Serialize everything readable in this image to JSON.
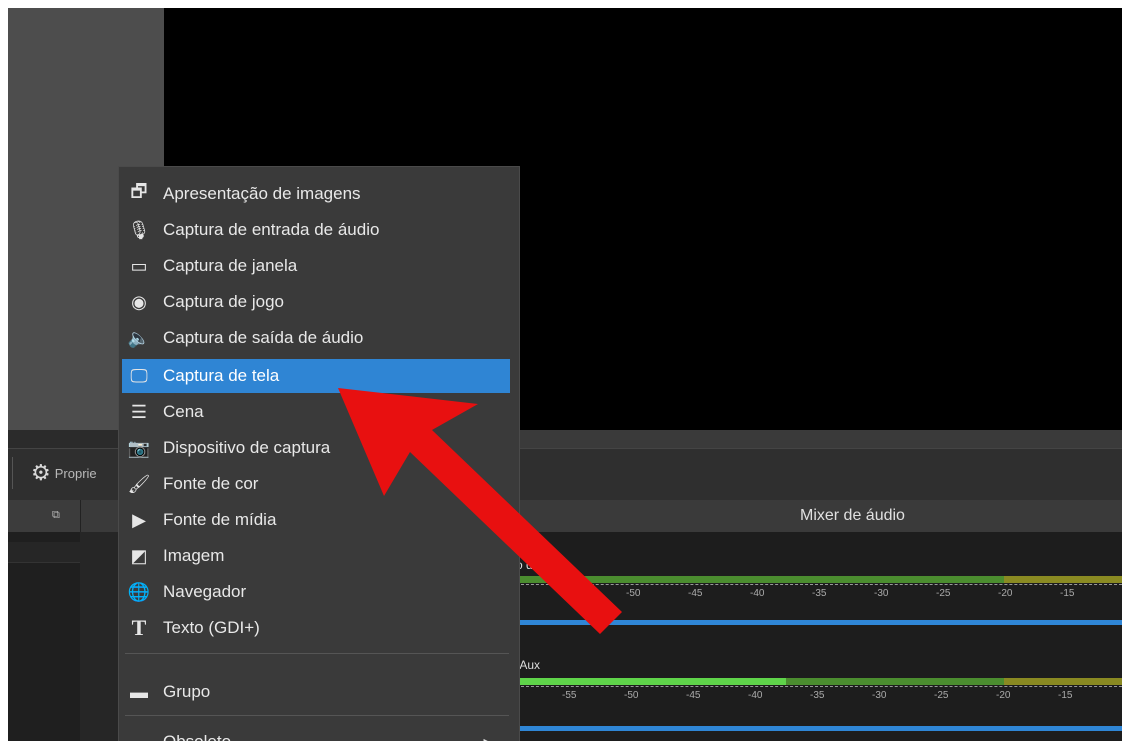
{
  "toolbar": {
    "properties_label": "Proprie"
  },
  "mixer": {
    "title": "Mixer de áudio",
    "tracks": [
      {
        "label": "o desktop",
        "ticks": [
          "-50",
          "-45",
          "-40",
          "-35",
          "-30",
          "-25",
          "-20",
          "-15"
        ]
      },
      {
        "label": "/Aux",
        "ticks": [
          "-55",
          "-50",
          "-45",
          "-40",
          "-35",
          "-30",
          "-25",
          "-20",
          "-15"
        ]
      }
    ]
  },
  "menu": {
    "items": [
      {
        "label": "Apresentação de imagens",
        "icon": "slideshow-icon"
      },
      {
        "label": "Captura de entrada de áudio",
        "icon": "microphone-icon"
      },
      {
        "label": "Captura de janela",
        "icon": "window-icon"
      },
      {
        "label": "Captura de jogo",
        "icon": "gamepad-icon"
      },
      {
        "label": "Captura de saída de áudio",
        "icon": "speaker-icon"
      },
      {
        "label": "Captura de tela",
        "icon": "monitor-icon",
        "selected": true
      },
      {
        "label": "Cena",
        "icon": "list-icon"
      },
      {
        "label": "Dispositivo de captura",
        "icon": "camera-icon"
      },
      {
        "label": "Fonte de cor",
        "icon": "brush-icon"
      },
      {
        "label": "Fonte de mídia",
        "icon": "play-icon"
      },
      {
        "label": "Imagem",
        "icon": "image-icon"
      },
      {
        "label": "Navegador",
        "icon": "globe-icon"
      },
      {
        "label": "Texto (GDI+)",
        "icon": "text-icon"
      },
      {
        "label": "Grupo",
        "icon": "folder-icon"
      },
      {
        "label": "Obsoleto",
        "icon": ""
      }
    ]
  },
  "colors": {
    "selection": "#2f85d4",
    "arrow": "#e81010",
    "meter_green": "#5fd44a",
    "volume_blue": "#2f86d6"
  }
}
